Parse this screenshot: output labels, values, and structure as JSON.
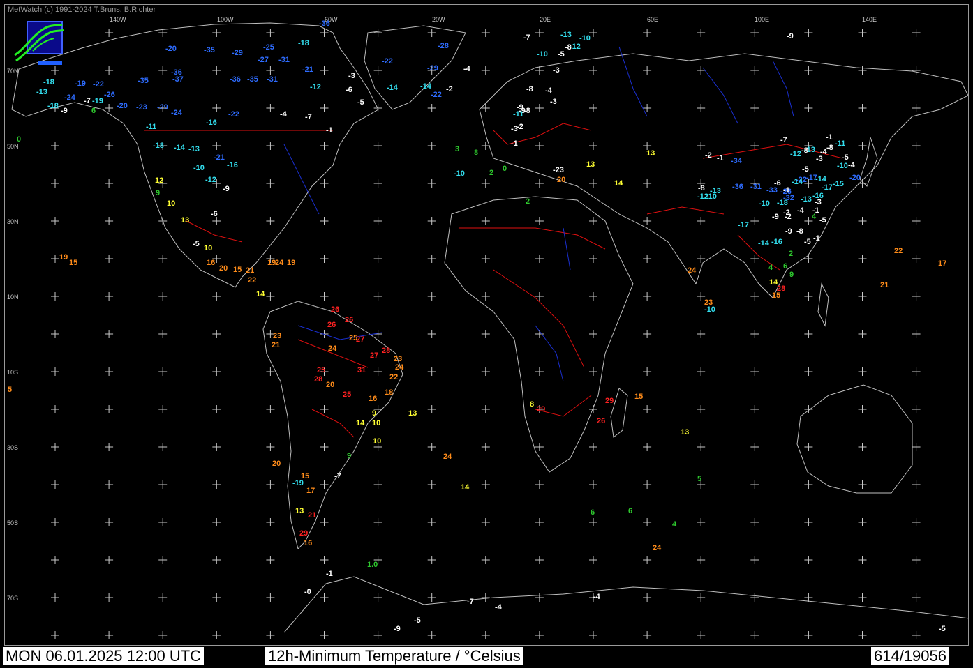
{
  "copyright": "MetWatch  (c) 1991-2024 T.Bruns, B.Richter",
  "status": {
    "datetime": "MON 06.01.2025 12:00 UTC",
    "title": "12h-Minimum Temperature / °Celsius",
    "count": "614/19056"
  },
  "icons": {
    "logo": "metwatch-logo-icon"
  },
  "colors": {
    "background": "#000000",
    "coastline": "#bfbfbf",
    "borders": "#e01010",
    "rivers": "#1a2fd0",
    "grid": "#c8c8c8",
    "cold": "#2e6cff",
    "cool": "#33e0f0",
    "freezing": "#ffffff",
    "mild": "#2ec82e",
    "warm": "#ffff33",
    "hot": "#ff8c1a",
    "veryhot": "#ff2222"
  },
  "axis_labels": {
    "longitude": [
      "140W",
      "100W",
      "60W",
      "20W",
      "20E",
      "60E",
      "100E",
      "140E"
    ],
    "latitude": [
      "70N",
      "50N",
      "30N",
      "10N",
      "10S",
      "30S",
      "50S",
      "70S"
    ]
  },
  "observations": [
    {
      "v": "-36",
      "c": "cold"
    },
    {
      "v": "-18",
      "c": "cool"
    },
    {
      "v": "-28",
      "c": "cold"
    },
    {
      "v": "-22",
      "c": "cold"
    },
    {
      "v": "-29",
      "c": "cold"
    },
    {
      "v": "-20",
      "c": "cold"
    },
    {
      "v": "-35",
      "c": "cold"
    },
    {
      "v": "-29",
      "c": "cold"
    },
    {
      "v": "-25",
      "c": "cold"
    },
    {
      "v": "-27",
      "c": "cold"
    },
    {
      "v": "-31",
      "c": "cold"
    },
    {
      "v": "-21",
      "c": "cold"
    },
    {
      "v": "-18",
      "c": "cool"
    },
    {
      "v": "-13",
      "c": "cool"
    },
    {
      "v": "-19",
      "c": "cold"
    },
    {
      "v": "-22",
      "c": "cold"
    },
    {
      "v": "-24",
      "c": "cold"
    },
    {
      "v": "-26",
      "c": "cold"
    },
    {
      "v": "-35",
      "c": "cold"
    },
    {
      "v": "-36",
      "c": "cold"
    },
    {
      "v": "-37",
      "c": "cold"
    },
    {
      "v": "-36",
      "c": "cold"
    },
    {
      "v": "-35",
      "c": "cold"
    },
    {
      "v": "-31",
      "c": "cold"
    },
    {
      "v": "-12",
      "c": "cool"
    },
    {
      "v": "-14",
      "c": "cool"
    },
    {
      "v": "-18",
      "c": "cool"
    },
    {
      "v": "-9",
      "c": "freezing"
    },
    {
      "v": "-7",
      "c": "freezing"
    },
    {
      "v": "-19",
      "c": "cool"
    },
    {
      "v": "6",
      "c": "mild"
    },
    {
      "v": "-20",
      "c": "cold"
    },
    {
      "v": "-23",
      "c": "cold"
    },
    {
      "v": "-29",
      "c": "cold"
    },
    {
      "v": "-24",
      "c": "cold"
    },
    {
      "v": "-16",
      "c": "cool"
    },
    {
      "v": "-22",
      "c": "cold"
    },
    {
      "v": "-11",
      "c": "cool"
    },
    {
      "v": "-18",
      "c": "cool"
    },
    {
      "v": "-14",
      "c": "cool"
    },
    {
      "v": "-13",
      "c": "cool"
    },
    {
      "v": "-21",
      "c": "cold"
    },
    {
      "v": "-16",
      "c": "cool"
    },
    {
      "v": "-10",
      "c": "cool"
    },
    {
      "v": "-12",
      "c": "cool"
    },
    {
      "v": "-9",
      "c": "freezing"
    },
    {
      "v": "-6",
      "c": "freezing"
    },
    {
      "v": "12",
      "c": "warm"
    },
    {
      "v": "9",
      "c": "mild"
    },
    {
      "v": "10",
      "c": "warm"
    },
    {
      "v": "13",
      "c": "warm"
    },
    {
      "v": "-5",
      "c": "freezing"
    },
    {
      "v": "10",
      "c": "warm"
    },
    {
      "v": "16",
      "c": "hot"
    },
    {
      "v": "20",
      "c": "hot"
    },
    {
      "v": "15",
      "c": "hot"
    },
    {
      "v": "21",
      "c": "hot"
    },
    {
      "v": "22",
      "c": "hot"
    },
    {
      "v": "14",
      "c": "warm"
    },
    {
      "v": "19",
      "c": "hot"
    },
    {
      "v": "24",
      "c": "hot"
    },
    {
      "v": "19",
      "c": "hot"
    },
    {
      "v": "-4",
      "c": "freezing"
    },
    {
      "v": "-1",
      "c": "freezing"
    },
    {
      "v": "-7",
      "c": "freezing"
    },
    {
      "v": "-3",
      "c": "freezing"
    },
    {
      "v": "-6",
      "c": "freezing"
    },
    {
      "v": "-5",
      "c": "freezing"
    },
    {
      "v": "-14",
      "c": "cool"
    },
    {
      "v": "-22",
      "c": "cold"
    },
    {
      "v": "-2",
      "c": "freezing"
    },
    {
      "v": "-4",
      "c": "freezing"
    },
    {
      "v": "-1",
      "c": "freezing"
    },
    {
      "v": "-2",
      "c": "freezing"
    },
    {
      "v": "-9",
      "c": "freezing"
    },
    {
      "v": "-8",
      "c": "freezing"
    },
    {
      "v": "-3",
      "c": "freezing"
    },
    {
      "v": "-5",
      "c": "freezing"
    },
    {
      "v": "-7",
      "c": "freezing"
    },
    {
      "v": "-8",
      "c": "freezing"
    },
    {
      "v": "-10",
      "c": "cool"
    },
    {
      "v": "-13",
      "c": "cool"
    },
    {
      "v": "-12",
      "c": "cool"
    },
    {
      "v": "-10",
      "c": "cool"
    },
    {
      "v": "-4",
      "c": "freezing"
    },
    {
      "v": "-3",
      "c": "freezing"
    },
    {
      "v": "3",
      "c": "mild"
    },
    {
      "v": "8",
      "c": "mild"
    },
    {
      "v": "2",
      "c": "mild"
    },
    {
      "v": "0",
      "c": "mild"
    },
    {
      "v": "-10",
      "c": "cool"
    },
    {
      "v": "-9",
      "c": "freezing"
    },
    {
      "v": "-11",
      "c": "cool"
    },
    {
      "v": "-8",
      "c": "freezing"
    },
    {
      "v": "-3",
      "c": "freezing"
    },
    {
      "v": "-23",
      "c": "freezing"
    },
    {
      "v": "20",
      "c": "hot"
    },
    {
      "v": "13",
      "c": "warm"
    },
    {
      "v": "14",
      "c": "warm"
    },
    {
      "v": "2",
      "c": "mild"
    },
    {
      "v": "13",
      "c": "warm"
    },
    {
      "v": "24",
      "c": "hot"
    },
    {
      "v": "23",
      "c": "hot"
    },
    {
      "v": "-10",
      "c": "cool"
    },
    {
      "v": "-9",
      "c": "freezing"
    },
    {
      "v": "-8",
      "c": "freezing"
    },
    {
      "v": "-12",
      "c": "cool"
    },
    {
      "v": "-13",
      "c": "cool"
    },
    {
      "v": "-3",
      "c": "freezing"
    },
    {
      "v": "-5",
      "c": "freezing"
    },
    {
      "v": "-10",
      "c": "cool"
    },
    {
      "v": "-20",
      "c": "cold"
    },
    {
      "v": "-4",
      "c": "freezing"
    },
    {
      "v": "-7",
      "c": "freezing"
    },
    {
      "v": "-1",
      "c": "freezing"
    },
    {
      "v": "-11",
      "c": "cool"
    },
    {
      "v": "-8",
      "c": "freezing"
    },
    {
      "v": "-4",
      "c": "freezing"
    },
    {
      "v": "-2",
      "c": "freezing"
    },
    {
      "v": "-1",
      "c": "freezing"
    },
    {
      "v": "-34",
      "c": "cold"
    },
    {
      "v": "-36",
      "c": "cold"
    },
    {
      "v": "-31",
      "c": "cold"
    },
    {
      "v": "-33",
      "c": "cold"
    },
    {
      "v": "-26",
      "c": "cold"
    },
    {
      "v": "-32",
      "c": "cold"
    },
    {
      "v": "-22",
      "c": "cold"
    },
    {
      "v": "-17",
      "c": "cold"
    },
    {
      "v": "-14",
      "c": "cool"
    },
    {
      "v": "-17",
      "c": "cool"
    },
    {
      "v": "-16",
      "c": "cool"
    },
    {
      "v": "-15",
      "c": "cool"
    },
    {
      "v": "-13",
      "c": "cool"
    },
    {
      "v": "-18",
      "c": "cool"
    },
    {
      "v": "-17",
      "c": "cool"
    },
    {
      "v": "-14",
      "c": "cool"
    },
    {
      "v": "-16",
      "c": "cool"
    },
    {
      "v": "-9",
      "c": "freezing"
    },
    {
      "v": "-8",
      "c": "freezing"
    },
    {
      "v": "-5",
      "c": "freezing"
    },
    {
      "v": "-1",
      "c": "freezing"
    },
    {
      "v": "2",
      "c": "mild"
    },
    {
      "v": "4",
      "c": "mild"
    },
    {
      "v": "6",
      "c": "mild"
    },
    {
      "v": "9",
      "c": "mild"
    },
    {
      "v": "14",
      "c": "warm"
    },
    {
      "v": "28",
      "c": "veryhot"
    },
    {
      "v": "15",
      "c": "hot"
    },
    {
      "v": "22",
      "c": "hot"
    },
    {
      "v": "17",
      "c": "hot"
    },
    {
      "v": "21",
      "c": "hot"
    },
    {
      "v": "26",
      "c": "veryhot"
    },
    {
      "v": "26",
      "c": "veryhot"
    },
    {
      "v": "26",
      "c": "veryhot"
    },
    {
      "v": "23",
      "c": "hot"
    },
    {
      "v": "21",
      "c": "hot"
    },
    {
      "v": "24",
      "c": "hot"
    },
    {
      "v": "25",
      "c": "hot"
    },
    {
      "v": "27",
      "c": "veryhot"
    },
    {
      "v": "28",
      "c": "veryhot"
    },
    {
      "v": "27",
      "c": "veryhot"
    },
    {
      "v": "23",
      "c": "hot"
    },
    {
      "v": "24",
      "c": "hot"
    },
    {
      "v": "31",
      "c": "veryhot"
    },
    {
      "v": "25",
      "c": "veryhot"
    },
    {
      "v": "28",
      "c": "veryhot"
    },
    {
      "v": "25",
      "c": "veryhot"
    },
    {
      "v": "20",
      "c": "hot"
    },
    {
      "v": "22",
      "c": "hot"
    },
    {
      "v": "18",
      "c": "hot"
    },
    {
      "v": "16",
      "c": "hot"
    },
    {
      "v": "14",
      "c": "warm"
    },
    {
      "v": "10",
      "c": "warm"
    },
    {
      "v": "9",
      "c": "warm"
    },
    {
      "v": "13",
      "c": "warm"
    },
    {
      "v": "10",
      "c": "warm"
    },
    {
      "v": "9",
      "c": "mild"
    },
    {
      "v": "-7",
      "c": "freezing"
    },
    {
      "v": "15",
      "c": "hot"
    },
    {
      "v": "17",
      "c": "hot"
    },
    {
      "v": "-19",
      "c": "cool"
    },
    {
      "v": "13",
      "c": "warm"
    },
    {
      "v": "21",
      "c": "veryhot"
    },
    {
      "v": "29",
      "c": "veryhot"
    },
    {
      "v": "16",
      "c": "hot"
    },
    {
      "v": "20",
      "c": "hot"
    },
    {
      "v": "24",
      "c": "hot"
    },
    {
      "v": "14",
      "c": "warm"
    },
    {
      "v": "8",
      "c": "warm"
    },
    {
      "v": "29",
      "c": "veryhot"
    },
    {
      "v": "29",
      "c": "veryhot"
    },
    {
      "v": "26",
      "c": "veryhot"
    },
    {
      "v": "15",
      "c": "hot"
    },
    {
      "v": "13",
      "c": "warm"
    },
    {
      "v": "5",
      "c": "mild"
    },
    {
      "v": "6",
      "c": "mild"
    },
    {
      "v": "6",
      "c": "mild"
    },
    {
      "v": "4",
      "c": "mild"
    },
    {
      "v": "24",
      "c": "hot"
    },
    {
      "v": "19",
      "c": "hot"
    },
    {
      "v": "15",
      "c": "hot"
    },
    {
      "v": "5",
      "c": "hot"
    },
    {
      "v": "0",
      "c": "mild"
    },
    {
      "v": "-1",
      "c": "freezing"
    },
    {
      "v": "1.0",
      "c": "mild"
    },
    {
      "v": "-0",
      "c": "freezing"
    },
    {
      "v": "-7",
      "c": "freezing"
    },
    {
      "v": "-4",
      "c": "freezing"
    },
    {
      "v": "-4",
      "c": "freezing"
    },
    {
      "v": "-5",
      "c": "freezing"
    },
    {
      "v": "-9",
      "c": "freezing"
    },
    {
      "v": "-5",
      "c": "freezing"
    },
    {
      "v": "-2",
      "c": "freezing"
    },
    {
      "v": "-4",
      "c": "freezing"
    },
    {
      "v": "-1",
      "c": "freezing"
    },
    {
      "v": "4",
      "c": "mild"
    },
    {
      "v": "-5",
      "c": "freezing"
    },
    {
      "v": "-3",
      "c": "freezing"
    },
    {
      "v": "-6",
      "c": "freezing"
    },
    {
      "v": "-14",
      "c": "cool"
    },
    {
      "v": "-1",
      "c": "freezing"
    },
    {
      "v": "-10",
      "c": "cool"
    },
    {
      "v": "-9",
      "c": "freezing"
    },
    {
      "v": "-8",
      "c": "freezing"
    },
    {
      "v": "-13",
      "c": "cool"
    },
    {
      "v": "-12",
      "c": "cool"
    },
    {
      "v": "-10",
      "c": "cool"
    },
    {
      "v": "-5",
      "c": "freezing"
    },
    {
      "v": "-2",
      "c": "freezing"
    }
  ]
}
